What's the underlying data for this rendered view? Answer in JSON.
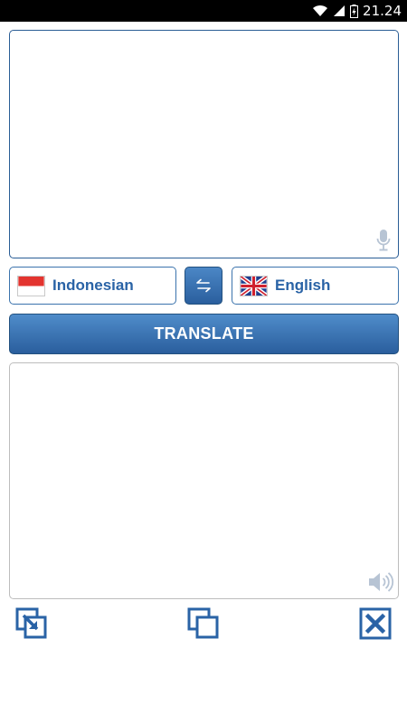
{
  "status_bar": {
    "time": "21.24"
  },
  "languages": {
    "source": {
      "label": "Indonesian",
      "flag": "flag-indonesia-icon"
    },
    "target": {
      "label": "English",
      "flag": "flag-uk-icon"
    }
  },
  "translate_button": {
    "label": "TRANSLATE"
  },
  "icons": {
    "mic": "microphone-icon",
    "speaker": "speaker-icon",
    "swap": "swap-arrows-icon",
    "share": "share-icon",
    "copy": "copy-icon",
    "clear": "clear-icon"
  },
  "colors": {
    "accent": "#2a63a6",
    "button_top": "#4f8cca",
    "button_bottom": "#2a5e9d",
    "border": "#3b73ad"
  }
}
